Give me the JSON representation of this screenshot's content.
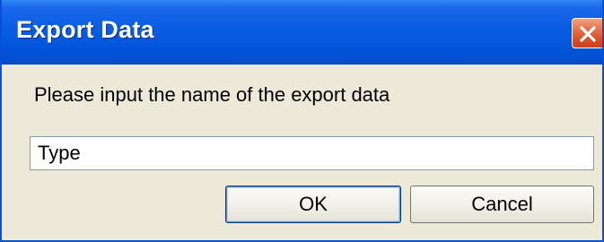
{
  "window": {
    "title": "Export Data"
  },
  "dialog": {
    "prompt": "Please input the name of the export data",
    "input_value": "Type",
    "ok_label": "OK",
    "cancel_label": "Cancel"
  },
  "icons": {
    "close": "close-icon"
  },
  "colors": {
    "titlebar": "#0a5fe2",
    "window_bg": "#ece9d8",
    "close_button": "#d9502a"
  }
}
